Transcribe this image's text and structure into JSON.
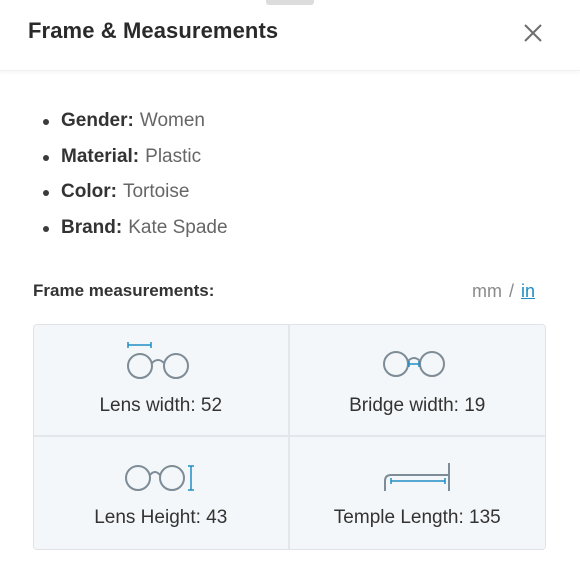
{
  "header": {
    "title": "Frame & Measurements"
  },
  "attributes": [
    {
      "key": "Gender:",
      "value": "Women"
    },
    {
      "key": "Material:",
      "value": "Plastic"
    },
    {
      "key": "Color:",
      "value": "Tortoise"
    },
    {
      "key": "Brand:",
      "value": "Kate Spade"
    }
  ],
  "measurements": {
    "section_title": "Frame measurements:",
    "unit_toggle": {
      "mm": "mm",
      "separator": "/",
      "in": "in",
      "selected": "mm"
    },
    "items": [
      {
        "icon": "lens-width-icon",
        "label": "Lens width: 52"
      },
      {
        "icon": "bridge-width-icon",
        "label": "Bridge width: 19"
      },
      {
        "icon": "lens-height-icon",
        "label": "Lens Height: 43"
      },
      {
        "icon": "temple-length-icon",
        "label": "Temple Length: 135"
      }
    ]
  },
  "colors": {
    "accent": "#1f8ec4",
    "icon_stroke": "#7d8c96"
  }
}
